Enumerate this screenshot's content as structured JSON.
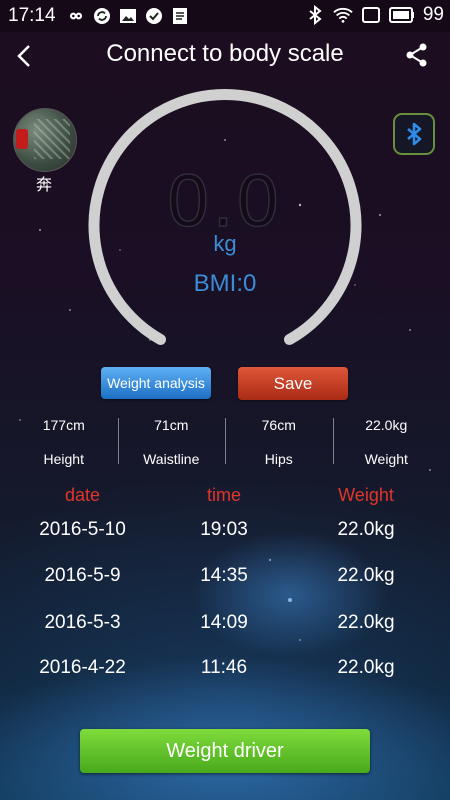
{
  "status_bar": {
    "time": "17:14",
    "battery": "99",
    "left_icons": [
      "infinity-icon",
      "sync-icon",
      "image-icon",
      "check-circle-icon",
      "clipboard-icon"
    ],
    "right_icons": [
      "bluetooth-icon",
      "wifi-icon",
      "screen-rotate-icon",
      "battery-icon"
    ]
  },
  "header": {
    "title": "Connect to body scale"
  },
  "user": {
    "name": "奔"
  },
  "gauge": {
    "value": "0.0",
    "unit": "kg",
    "bmi": "BMI:0"
  },
  "actions": {
    "analysis_label": "Weight analysis",
    "save_label": "Save"
  },
  "measurements": [
    {
      "value": "177cm",
      "label": "Height"
    },
    {
      "value": "71cm",
      "label": "Waistline"
    },
    {
      "value": "76cm",
      "label": "Hips"
    },
    {
      "value": "22.0kg",
      "label": "Weight"
    }
  ],
  "history": {
    "headers": {
      "date": "date",
      "time": "time",
      "weight": "Weight"
    },
    "rows": [
      {
        "date": "2016-5-10",
        "time": "19:03",
        "weight": "22.0kg"
      },
      {
        "date": "2016-5-9",
        "time": "14:35",
        "weight": "22.0kg"
      },
      {
        "date": "2016-5-3",
        "time": "14:09",
        "weight": "22.0kg"
      },
      {
        "date": "2016-4-22",
        "time": "11:46",
        "weight": "22.0kg"
      }
    ]
  },
  "footer": {
    "driver_label": "Weight driver"
  },
  "colors": {
    "accent_blue": "#3d8cd6",
    "header_red": "#e0362b",
    "save_red": "#c0391f",
    "driver_green": "#5fc12a",
    "gauge_gray": "#d0d0d0"
  }
}
